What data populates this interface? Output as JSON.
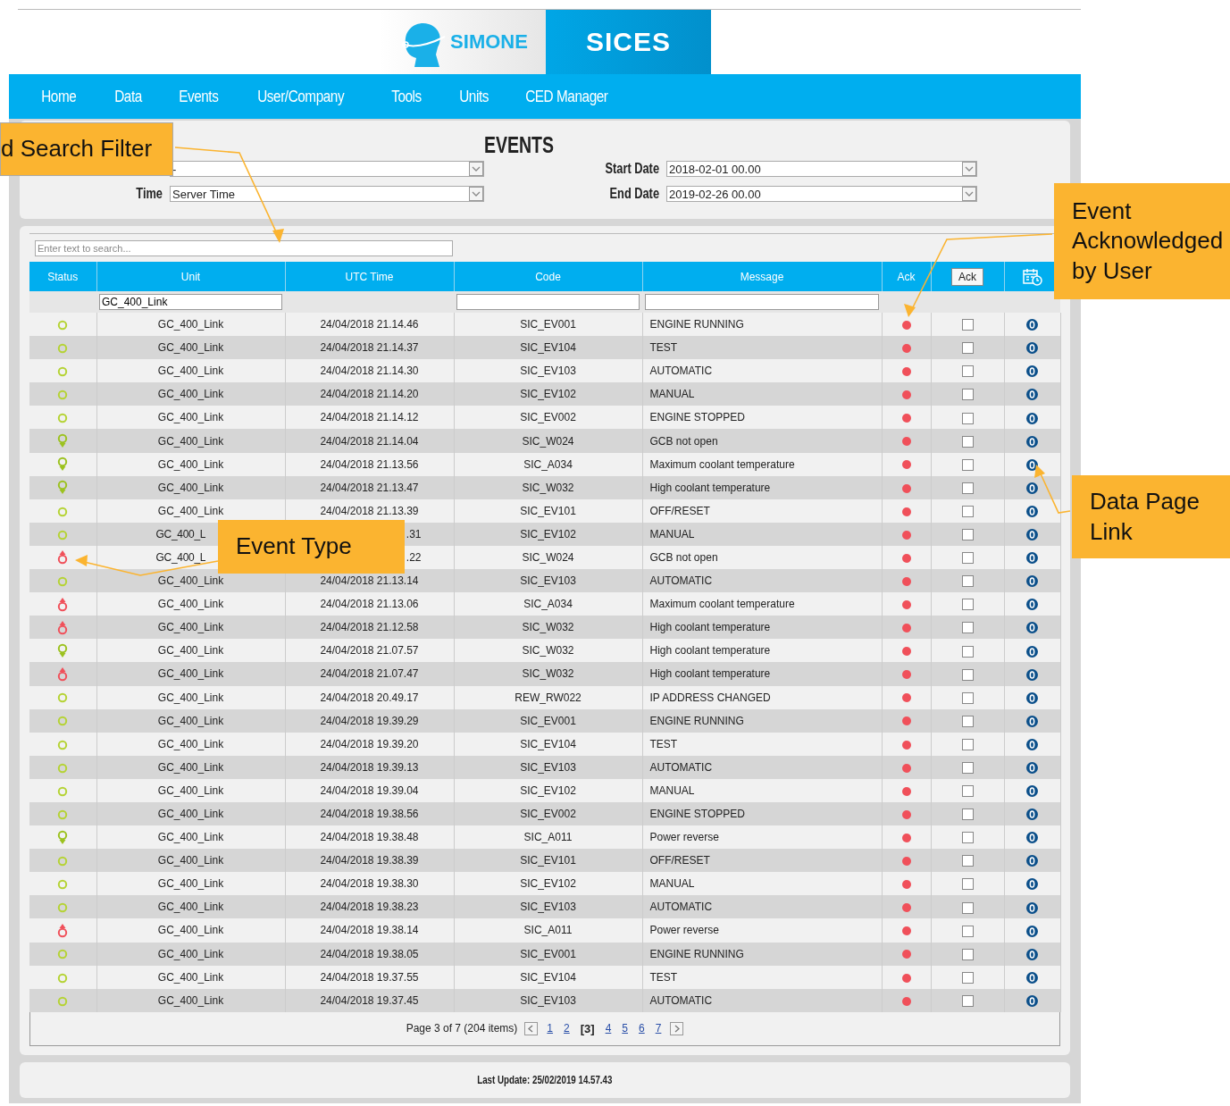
{
  "logos": {
    "product": "SIMONE",
    "brand": "SICES"
  },
  "nav": [
    {
      "label": "Home"
    },
    {
      "label": "Data"
    },
    {
      "label": "Events"
    },
    {
      "label": "User/Company"
    },
    {
      "label": "Tools"
    },
    {
      "label": "Units"
    },
    {
      "label": "CED Manager"
    }
  ],
  "filters": {
    "title": "EVENTS",
    "time_label": "Time",
    "company_value": "-",
    "time_value": "Server Time",
    "start_label": "Start Date",
    "start_value": "2018-02-01 00.00",
    "end_label": "End Date",
    "end_value": "2019-02-26 00.00"
  },
  "search": {
    "placeholder": "Enter text to search..."
  },
  "table": {
    "columns": [
      "Status",
      "Unit",
      "UTC Time",
      "Code",
      "Message",
      "Ack"
    ],
    "ack_button": "Ack",
    "unit_filter": "GC_400_Link",
    "rows": [
      {
        "kind": "ok",
        "unit": "GC_400_Link",
        "time": "24/04/2018 21.14.46",
        "covered": false,
        "code": "SIC_EV001",
        "message": "ENGINE RUNNING",
        "acknowledged": false,
        "checked": false
      },
      {
        "kind": "ok",
        "unit": "GC_400_Link",
        "time": "24/04/2018 21.14.37",
        "covered": false,
        "code": "SIC_EV104",
        "message": "TEST",
        "acknowledged": false,
        "checked": false
      },
      {
        "kind": "ok",
        "unit": "GC_400_Link",
        "time": "24/04/2018 21.14.30",
        "covered": false,
        "code": "SIC_EV103",
        "message": "AUTOMATIC",
        "acknowledged": false,
        "checked": false
      },
      {
        "kind": "ok",
        "unit": "GC_400_Link",
        "time": "24/04/2018 21.14.20",
        "covered": false,
        "code": "SIC_EV102",
        "message": "MANUAL",
        "acknowledged": false,
        "checked": false
      },
      {
        "kind": "ok",
        "unit": "GC_400_Link",
        "time": "24/04/2018 21.14.12",
        "covered": false,
        "code": "SIC_EV002",
        "message": "ENGINE STOPPED",
        "acknowledged": false,
        "checked": false
      },
      {
        "kind": "down",
        "unit": "GC_400_Link",
        "time": "24/04/2018 21.14.04",
        "covered": false,
        "code": "SIC_W024",
        "message": "GCB not open",
        "acknowledged": false,
        "checked": false
      },
      {
        "kind": "down",
        "unit": "GC_400_Link",
        "time": "24/04/2018 21.13.56",
        "covered": false,
        "code": "SIC_A034",
        "message": "Maximum coolant temperature",
        "acknowledged": false,
        "checked": false
      },
      {
        "kind": "down",
        "unit": "GC_400_Link",
        "time": "24/04/2018 21.13.47",
        "covered": false,
        "code": "SIC_W032",
        "message": "High coolant temperature",
        "acknowledged": false,
        "checked": false
      },
      {
        "kind": "ok",
        "unit": "GC_400_Link",
        "time": "24/04/2018 21.13.39",
        "covered": false,
        "code": "SIC_EV101",
        "message": "OFF/RESET",
        "acknowledged": false,
        "checked": false
      },
      {
        "kind": "ok",
        "unit": "GC_400_L",
        "time": ".31",
        "covered": true,
        "code": "SIC_EV102",
        "message": "MANUAL",
        "acknowledged": false,
        "checked": false
      },
      {
        "kind": "up",
        "unit": "GC_400_L",
        "time": ".22",
        "covered": true,
        "code": "SIC_W024",
        "message": "GCB not open",
        "acknowledged": false,
        "checked": false
      },
      {
        "kind": "ok",
        "unit": "GC_400_Link",
        "time": "24/04/2018 21.13.14",
        "covered": false,
        "code": "SIC_EV103",
        "message": "AUTOMATIC",
        "acknowledged": false,
        "checked": false
      },
      {
        "kind": "up",
        "unit": "GC_400_Link",
        "time": "24/04/2018 21.13.06",
        "covered": false,
        "code": "SIC_A034",
        "message": "Maximum coolant temperature",
        "acknowledged": false,
        "checked": false
      },
      {
        "kind": "up",
        "unit": "GC_400_Link",
        "time": "24/04/2018 21.12.58",
        "covered": false,
        "code": "SIC_W032",
        "message": "High coolant temperature",
        "acknowledged": false,
        "checked": false
      },
      {
        "kind": "down",
        "unit": "GC_400_Link",
        "time": "24/04/2018 21.07.57",
        "covered": false,
        "code": "SIC_W032",
        "message": "High coolant temperature",
        "acknowledged": false,
        "checked": false
      },
      {
        "kind": "up",
        "unit": "GC_400_Link",
        "time": "24/04/2018 21.07.47",
        "covered": false,
        "code": "SIC_W032",
        "message": "High coolant temperature",
        "acknowledged": false,
        "checked": false
      },
      {
        "kind": "ok",
        "unit": "GC_400_Link",
        "time": "24/04/2018 20.49.17",
        "covered": false,
        "code": "REW_RW022",
        "message": "IP ADDRESS CHANGED",
        "acknowledged": false,
        "checked": false
      },
      {
        "kind": "ok",
        "unit": "GC_400_Link",
        "time": "24/04/2018 19.39.29",
        "covered": false,
        "code": "SIC_EV001",
        "message": "ENGINE RUNNING",
        "acknowledged": false,
        "checked": false
      },
      {
        "kind": "ok",
        "unit": "GC_400_Link",
        "time": "24/04/2018 19.39.20",
        "covered": false,
        "code": "SIC_EV104",
        "message": "TEST",
        "acknowledged": false,
        "checked": false
      },
      {
        "kind": "ok",
        "unit": "GC_400_Link",
        "time": "24/04/2018 19.39.13",
        "covered": false,
        "code": "SIC_EV103",
        "message": "AUTOMATIC",
        "acknowledged": false,
        "checked": false
      },
      {
        "kind": "ok",
        "unit": "GC_400_Link",
        "time": "24/04/2018 19.39.04",
        "covered": false,
        "code": "SIC_EV102",
        "message": "MANUAL",
        "acknowledged": false,
        "checked": false
      },
      {
        "kind": "ok",
        "unit": "GC_400_Link",
        "time": "24/04/2018 19.38.56",
        "covered": false,
        "code": "SIC_EV002",
        "message": "ENGINE STOPPED",
        "acknowledged": false,
        "checked": false
      },
      {
        "kind": "down",
        "unit": "GC_400_Link",
        "time": "24/04/2018 19.38.48",
        "covered": false,
        "code": "SIC_A011",
        "message": "Power reverse",
        "acknowledged": false,
        "checked": false
      },
      {
        "kind": "ok",
        "unit": "GC_400_Link",
        "time": "24/04/2018 19.38.39",
        "covered": false,
        "code": "SIC_EV101",
        "message": "OFF/RESET",
        "acknowledged": false,
        "checked": false
      },
      {
        "kind": "ok",
        "unit": "GC_400_Link",
        "time": "24/04/2018 19.38.30",
        "covered": false,
        "code": "SIC_EV102",
        "message": "MANUAL",
        "acknowledged": false,
        "checked": false
      },
      {
        "kind": "ok",
        "unit": "GC_400_Link",
        "time": "24/04/2018 19.38.23",
        "covered": false,
        "code": "SIC_EV103",
        "message": "AUTOMATIC",
        "acknowledged": false,
        "checked": false
      },
      {
        "kind": "up",
        "unit": "GC_400_Link",
        "time": "24/04/2018 19.38.14",
        "covered": false,
        "code": "SIC_A011",
        "message": "Power reverse",
        "acknowledged": false,
        "checked": false
      },
      {
        "kind": "ok",
        "unit": "GC_400_Link",
        "time": "24/04/2018 19.38.05",
        "covered": false,
        "code": "SIC_EV001",
        "message": "ENGINE RUNNING",
        "acknowledged": false,
        "checked": false
      },
      {
        "kind": "ok",
        "unit": "GC_400_Link",
        "time": "24/04/2018 19.37.55",
        "covered": false,
        "code": "SIC_EV104",
        "message": "TEST",
        "acknowledged": false,
        "checked": false
      },
      {
        "kind": "ok",
        "unit": "GC_400_Link",
        "time": "24/04/2018 19.37.45",
        "covered": false,
        "code": "SIC_EV103",
        "message": "AUTOMATIC",
        "acknowledged": false,
        "checked": false
      }
    ]
  },
  "pager": {
    "summary": "Page 3 of 7 (204 items)",
    "pages": [
      {
        "label": "1",
        "selected": false
      },
      {
        "label": "2",
        "selected": false
      },
      {
        "label": "[3]",
        "selected": true
      },
      {
        "label": "4",
        "selected": false
      },
      {
        "label": "5",
        "selected": false
      },
      {
        "label": "6",
        "selected": false
      },
      {
        "label": "7",
        "selected": false
      }
    ]
  },
  "footer": {
    "last_update": "Last Update: 25/02/2019 14.57.43"
  },
  "callouts": [
    {
      "kind": "search",
      "text": "d Search Filter"
    },
    {
      "kind": "ack",
      "text": "Event Acknowledged by User"
    },
    {
      "kind": "datalink",
      "text": "Data Page Link"
    },
    {
      "kind": "type",
      "text": "Event Type"
    }
  ]
}
